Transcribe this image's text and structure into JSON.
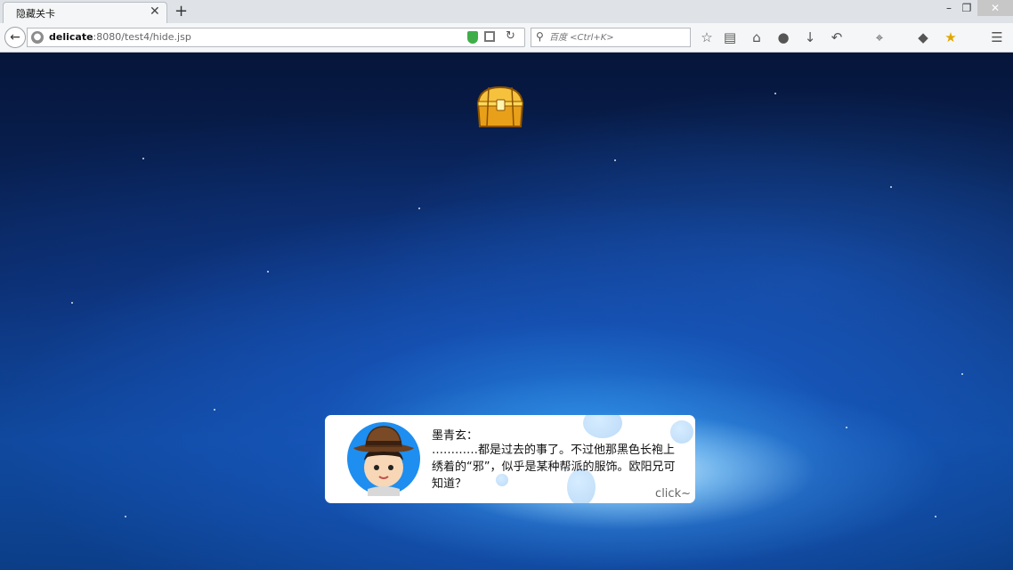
{
  "browser": {
    "tab_title": "隐藏关卡",
    "tab_close": "✕",
    "new_tab": "+",
    "url_host": "delicate",
    "url_rest": ":8080/test4/hide.jsp",
    "search_placeholder": "百度 <Ctrl+K>",
    "window_controls": {
      "minimize": "–",
      "restore": "❐",
      "close": "✕"
    }
  },
  "game": {
    "dialog": {
      "speaker": "墨青玄：",
      "text": "…………都是过去的事了。不过他那黑色长袍上绣着的“邪”，似乎是某种帮派的服饰。欧阳兄可知道？",
      "continue_hint": "click~"
    }
  },
  "colors": {
    "dialog_bg": "#ffffff",
    "sky_top": "#06153a",
    "galaxy_core": "#e6f8ff"
  },
  "icons": [
    "back-icon",
    "site-info-icon",
    "shield-icon",
    "qr-code-icon",
    "reload-icon",
    "search-icon",
    "bookmark-star-icon",
    "reading-list-icon",
    "home-icon",
    "chat-icon",
    "download-icon",
    "undo-icon",
    "crop-icon",
    "speech-bubble-icon",
    "extension-icon",
    "menu-icon",
    "treasure-chest-icon"
  ]
}
